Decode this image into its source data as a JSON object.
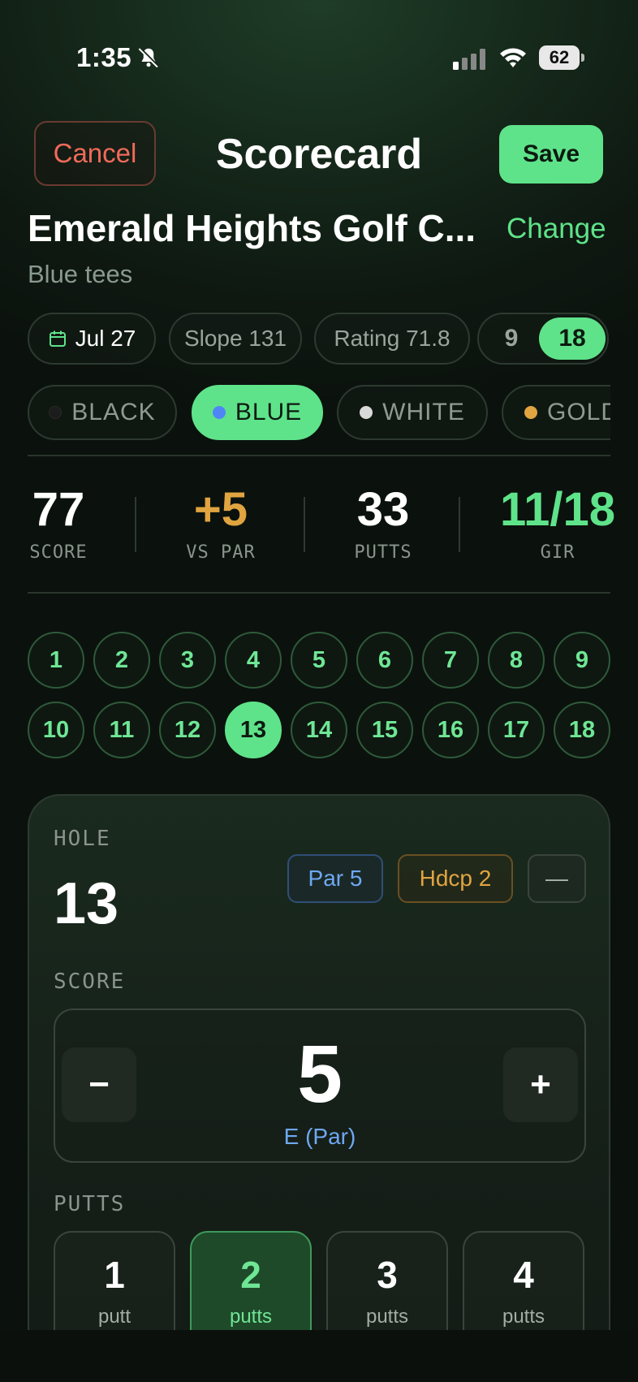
{
  "status": {
    "time": "1:35",
    "battery": "62"
  },
  "header": {
    "cancel_label": "Cancel",
    "title": "Scorecard",
    "save_label": "Save"
  },
  "course": {
    "name": "Emerald Heights Golf C...",
    "change_label": "Change",
    "tees": "Blue tees"
  },
  "chips": {
    "date": "Jul 27",
    "slope": "Slope 131",
    "rating": "Rating 71.8",
    "holes_9": "9",
    "holes_18": "18",
    "holes_selected": "18"
  },
  "tee_options": [
    {
      "label": "BLACK",
      "color": "#1a1a1a"
    },
    {
      "label": "BLUE",
      "color": "#4f86f7",
      "selected": true
    },
    {
      "label": "WHITE",
      "color": "#d9d9d9"
    },
    {
      "label": "GOLD",
      "color": "#e0a440"
    }
  ],
  "stats": [
    {
      "value": "77",
      "label": "SCORE",
      "color": "#ffffff"
    },
    {
      "value": "+5",
      "label": "VS PAR",
      "color": "#e0a440"
    },
    {
      "value": "33",
      "label": "PUTTS",
      "color": "#ffffff"
    },
    {
      "value": "11/18",
      "label": "GIR",
      "color": "#5fe38a"
    }
  ],
  "holes": [
    "1",
    "2",
    "3",
    "4",
    "5",
    "6",
    "7",
    "8",
    "9",
    "10",
    "11",
    "12",
    "13",
    "14",
    "15",
    "16",
    "17",
    "18"
  ],
  "selected_hole": "13",
  "card": {
    "hole_label": "HOLE",
    "hole_number": "13",
    "par_badge": "Par 5",
    "hdcp_badge": "Hdcp 2",
    "extra_badge": "—",
    "score_label": "SCORE",
    "minus_label": "−",
    "plus_label": "+",
    "score_value": "5",
    "score_relative": "E (Par)",
    "putts_label": "PUTTS",
    "putt_options": [
      {
        "num": "1",
        "unit": "putt"
      },
      {
        "num": "2",
        "unit": "putts",
        "selected": true
      },
      {
        "num": "3",
        "unit": "putts"
      },
      {
        "num": "4",
        "unit": "putts"
      }
    ]
  },
  "colors": {
    "accent": "#5fe38a",
    "danger": "#ef6a5a",
    "par": "#6ea8f2",
    "hdcp": "#e0a440"
  }
}
